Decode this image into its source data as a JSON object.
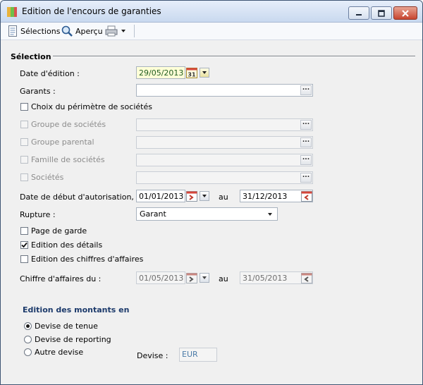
{
  "window": {
    "title": "Edition de l'encours de garanties"
  },
  "toolbar": {
    "selections_label": "Sélections",
    "apercu_label": "Aperçu"
  },
  "selection": {
    "section_title": "Sélection",
    "date_edition_label": "Date d'édition :",
    "date_edition_value": "29/05/2013",
    "date_calendar_text": "31",
    "garants_label": "Garants :",
    "garants_value": "",
    "choix_perimetre_label": "Choix du périmètre de sociétés",
    "groupe_societes_label": "Groupe de sociétés",
    "groupe_parental_label": "Groupe parental",
    "famille_societes_label": "Famille de sociétés",
    "societes_label": "Sociétés",
    "date_debut_label": "Date de début d'autorisation, du :",
    "date_debut_from": "01/01/2013",
    "au_label": "au",
    "date_debut_to": "31/12/2013",
    "rupture_label": "Rupture :",
    "rupture_value": "Garant",
    "page_garde_label": "Page de garde",
    "edition_details_label": "Edition des détails",
    "edition_chiffres_label": "Edition des chiffres d'affaires",
    "chiffre_affaires_label": "Chiffre d'affaires du :",
    "ca_from": "01/05/2013",
    "ca_au_label": "au",
    "ca_to": "31/05/2013"
  },
  "montants": {
    "section_title": "Edition des montants en",
    "devise_tenue_label": "Devise de tenue",
    "devise_reporting_label": "Devise de reporting",
    "autre_devise_label": "Autre devise",
    "devise_label": "Devise :",
    "devise_value": "EUR"
  },
  "colors": {
    "title_blue": "#1c3a6b",
    "date_green": "#1f5c1f",
    "close_red": "#c7452f"
  }
}
